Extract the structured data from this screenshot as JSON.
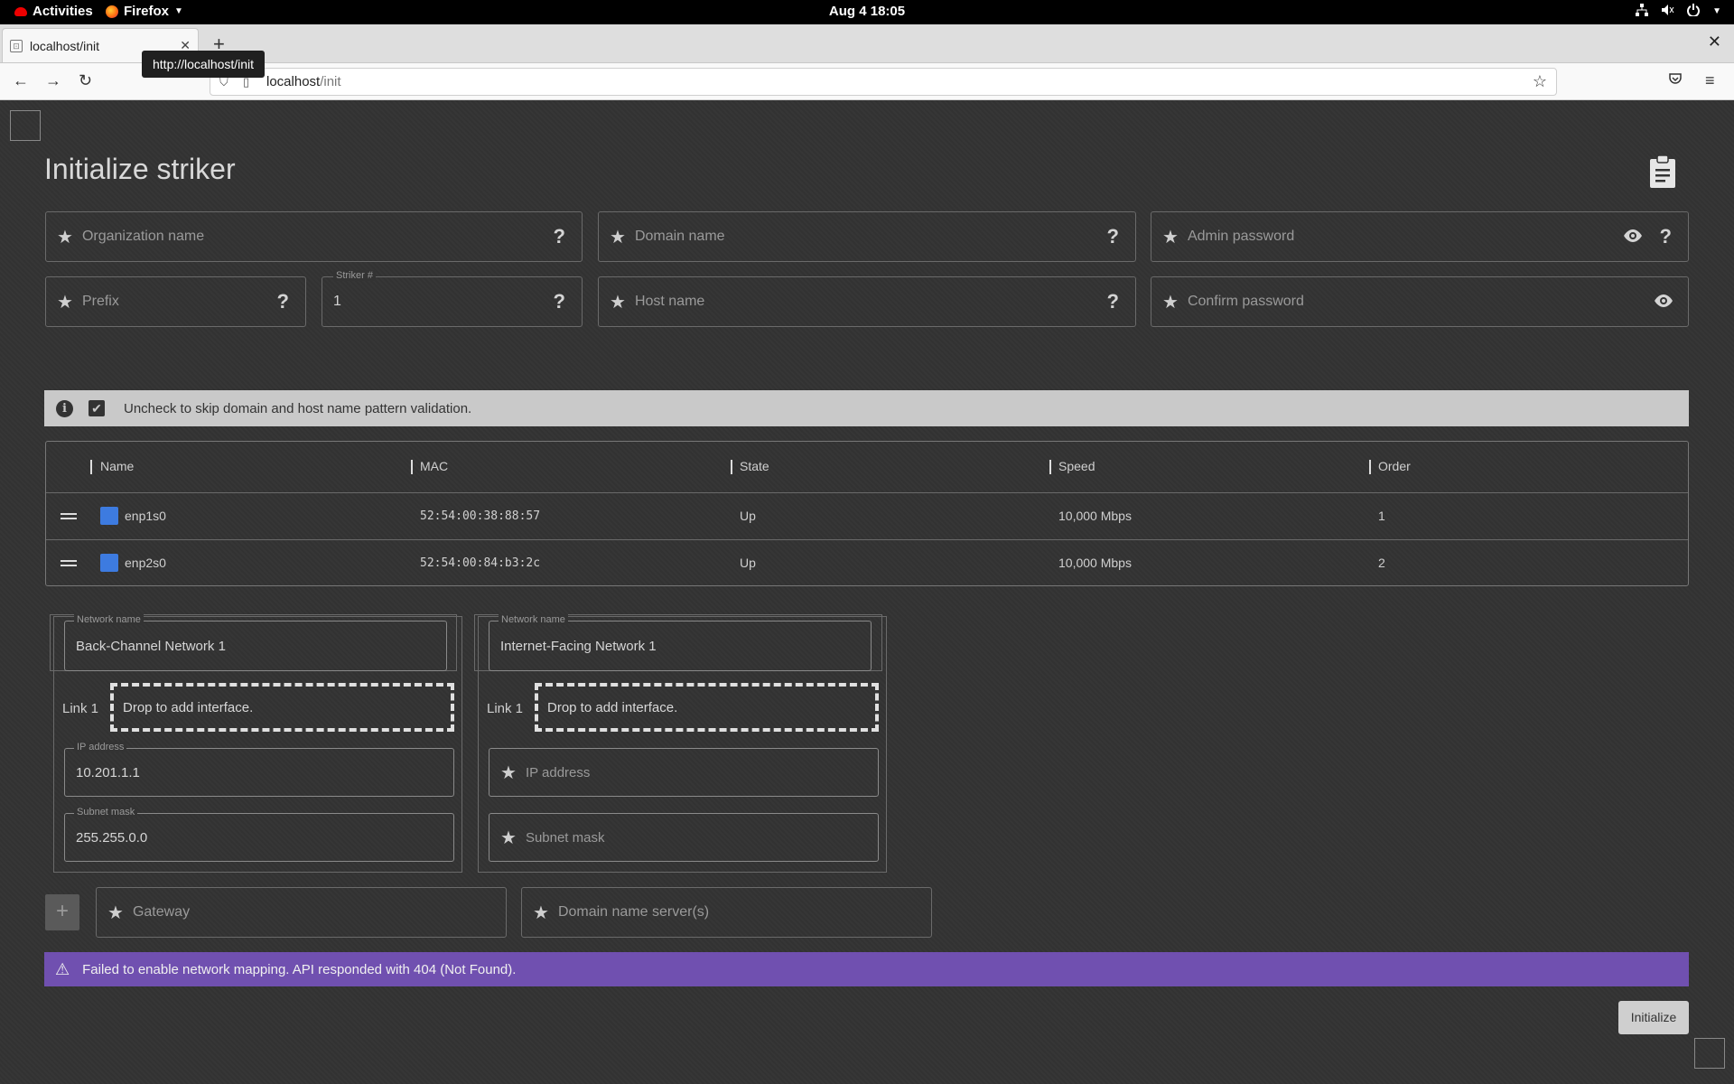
{
  "system_bar": {
    "activities": "Activities",
    "app_name": "Firefox",
    "clock": "Aug 4  18:05"
  },
  "browser": {
    "tab_title": "localhost/init",
    "tooltip": "http://localhost/init",
    "url_host": "localhost",
    "url_path": "/init"
  },
  "page": {
    "title": "Initialize striker",
    "fields": {
      "organization_name": "Organization name",
      "domain_name": "Domain name",
      "admin_password": "Admin password",
      "prefix": "Prefix",
      "striker_label": "Striker #",
      "striker_value": "1",
      "host_name": "Host name",
      "confirm_password": "Confirm password"
    },
    "validation_text": "Uncheck to skip domain and host name pattern validation.",
    "table": {
      "headers": [
        "Name",
        "MAC",
        "State",
        "Speed",
        "Order"
      ],
      "rows": [
        {
          "name": "enp1s0",
          "mac": "52:54:00:38:88:57",
          "state": "Up",
          "speed": "10,000 Mbps",
          "order": "1"
        },
        {
          "name": "enp2s0",
          "mac": "52:54:00:84:b3:2c",
          "state": "Up",
          "speed": "10,000 Mbps",
          "order": "2"
        }
      ]
    },
    "networks": [
      {
        "name_label": "Network name",
        "name_value": "Back-Channel Network 1",
        "link_label": "Link 1",
        "drop_text": "Drop to add interface.",
        "ip_label": "IP address",
        "ip_value": "10.201.1.1",
        "mask_label": "Subnet mask",
        "mask_value": "255.255.0.0"
      },
      {
        "name_label": "Network name",
        "name_value": "Internet-Facing Network 1",
        "link_label": "Link 1",
        "drop_text": "Drop to add interface.",
        "ip_placeholder": "IP address",
        "mask_placeholder": "Subnet mask"
      }
    ],
    "add_label": "+",
    "gateway_placeholder": "Gateway",
    "dns_placeholder": "Domain name server(s)",
    "error_text": "Failed to enable network mapping. API responded with 404 (Not Found).",
    "initialize_label": "Initialize"
  },
  "colors": {
    "accent_purple": "#7050b0",
    "nic_blue": "#3d7be0",
    "info_bg": "#c9c9c9"
  }
}
